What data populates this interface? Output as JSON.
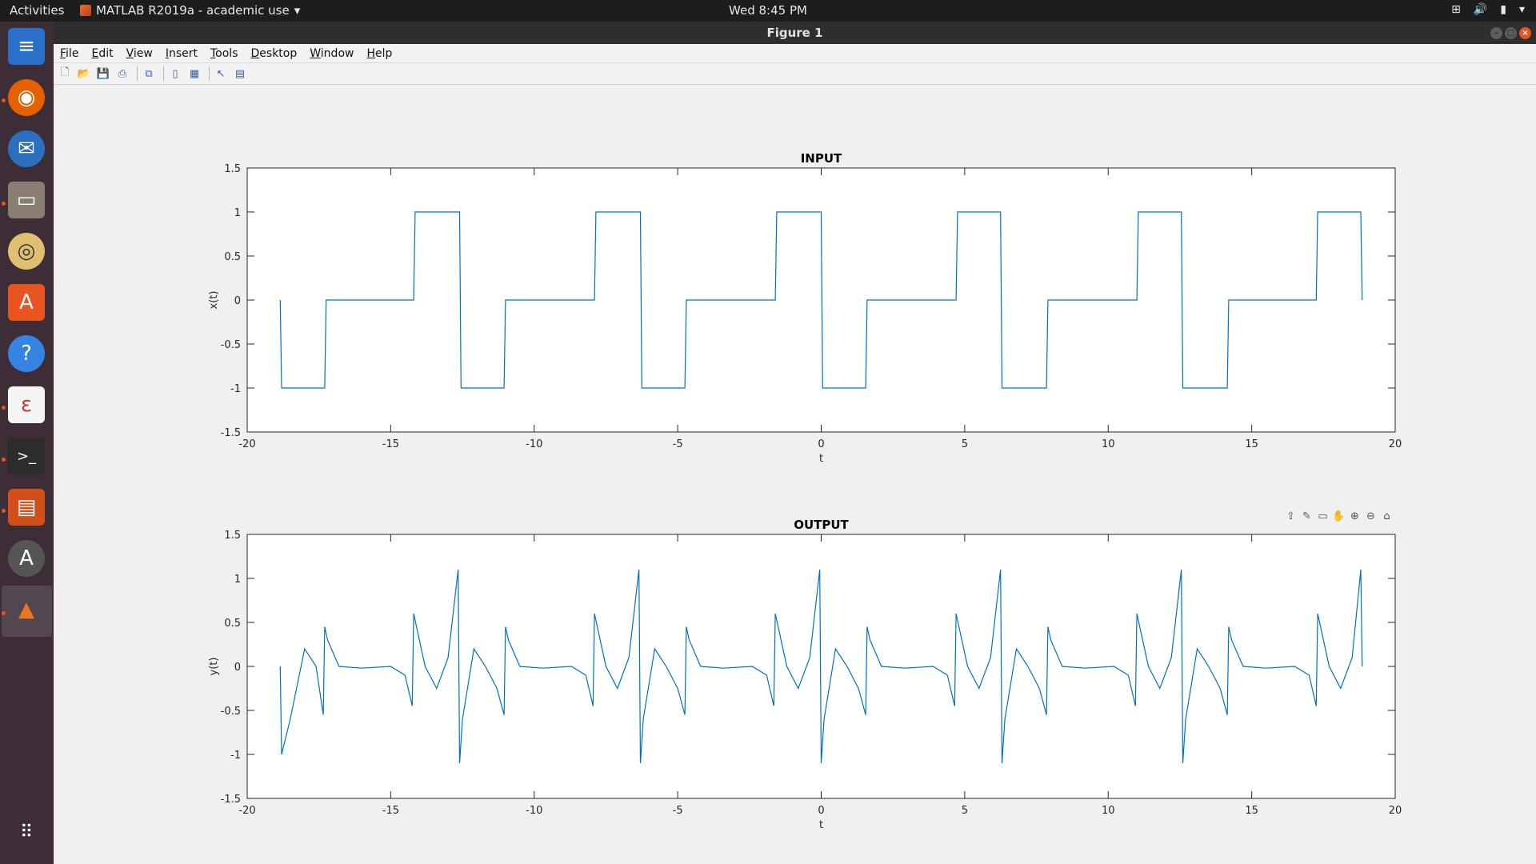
{
  "topbar": {
    "activities": "Activities",
    "app_menu": "MATLAB R2019a - academic use",
    "clock": "Wed  8:45 PM"
  },
  "window": {
    "title": "Figure 1",
    "menu": [
      "File",
      "Edit",
      "View",
      "Insert",
      "Tools",
      "Desktop",
      "Window",
      "Help"
    ]
  },
  "dock": {
    "items": [
      "libreoffice-writer-icon",
      "firefox-icon",
      "thunderbird-icon",
      "files-icon",
      "rhythmbox-icon",
      "software-center-icon",
      "help-icon",
      "document-viewer-icon",
      "terminal-icon",
      "libreoffice-impress-icon",
      "software-updater-icon",
      "matlab-icon",
      "show-applications-icon"
    ]
  },
  "toolbar": {
    "buttons": [
      "new-figure-icon",
      "open-file-icon",
      "save-icon",
      "print-icon",
      "link-plot-icon",
      "insert-colorbar-icon",
      "insert-legend-icon",
      "edit-plot-icon",
      "property-inspector-icon"
    ]
  },
  "axes_toolbar": {
    "buttons": [
      "export-icon",
      "brush-icon",
      "data-tips-icon",
      "pan-icon",
      "zoom-in-icon",
      "zoom-out-icon",
      "home-icon"
    ]
  },
  "colors": {
    "line": "#0072bd",
    "topbar": "#1d1d1d",
    "dock": "#3d2d36",
    "accent": "#e95420"
  },
  "chart_data": [
    {
      "type": "line",
      "title": "INPUT",
      "xlabel": "t",
      "ylabel": "x(t)",
      "xlim": [
        -20,
        20
      ],
      "ylim": [
        -1.5,
        1.5
      ],
      "xticks": [
        -20,
        -15,
        -10,
        -5,
        0,
        5,
        10,
        15,
        20
      ],
      "yticks": [
        -1.5,
        -1,
        -0.5,
        0,
        0.5,
        1,
        1.5
      ],
      "grid": false,
      "series": [
        {
          "description_of_shape": "",
          "x": [
            -18.85,
            -18.8,
            -17.3,
            -17.25,
            -14.2,
            -14.15,
            -12.6,
            -12.55,
            -11.05,
            -11.0,
            -7.9,
            -7.85,
            -6.3,
            -6.25,
            -4.75,
            -4.7,
            -1.6,
            -1.55,
            0.0,
            0.05,
            1.55,
            1.6,
            4.7,
            4.75,
            6.25,
            6.3,
            7.85,
            7.9,
            11.0,
            11.05,
            12.55,
            12.6,
            14.15,
            14.2,
            17.25,
            17.3,
            18.8,
            18.85
          ],
          "y": [
            0,
            -1,
            -1,
            0,
            0,
            1,
            1,
            -1,
            -1,
            0,
            0,
            1,
            1,
            -1,
            -1,
            0,
            0,
            1,
            1,
            -1,
            -1,
            0,
            0,
            1,
            1,
            -1,
            -1,
            0,
            0,
            1,
            1,
            -1,
            -1,
            0,
            0,
            1,
            1,
            0
          ]
        }
      ]
    },
    {
      "type": "line",
      "title": "OUTPUT",
      "xlabel": "t",
      "ylabel": "y(t)",
      "xlim": [
        -20,
        20
      ],
      "ylim": [
        -1.5,
        1.5
      ],
      "xticks": [
        -20,
        -15,
        -10,
        -5,
        0,
        5,
        10,
        15,
        20
      ],
      "yticks": [
        -1.5,
        -1,
        -0.5,
        0,
        0.5,
        1,
        1.5
      ],
      "grid": false,
      "series": [
        {
          "x": [
            -18.85,
            -18.8,
            -18.5,
            -18.0,
            -17.6,
            -17.35,
            -17.3,
            -17.2,
            -16.8,
            -16.0,
            -15.0,
            -14.5,
            -14.25,
            -14.2,
            -13.8,
            -13.4,
            -13.0,
            -12.65,
            -12.6,
            -12.5,
            -12.1,
            -11.7,
            -11.3,
            -11.05,
            -11.0,
            -10.9,
            -10.5,
            -9.7,
            -8.7,
            -8.2,
            -7.95,
            -7.9,
            -7.5,
            -7.1,
            -6.7,
            -6.35,
            -6.3,
            -6.2,
            -5.8,
            -5.4,
            -5.0,
            -4.75,
            -4.7,
            -4.6,
            -4.2,
            -3.4,
            -2.4,
            -1.9,
            -1.65,
            -1.6,
            -1.2,
            -0.8,
            -0.4,
            -0.05,
            0.0,
            0.1,
            0.5,
            0.9,
            1.3,
            1.55,
            1.6,
            1.7,
            2.1,
            2.9,
            3.9,
            4.4,
            4.65,
            4.7,
            5.1,
            5.5,
            5.9,
            6.25,
            6.3,
            6.4,
            6.8,
            7.2,
            7.6,
            7.85,
            7.9,
            8.0,
            8.4,
            9.2,
            10.2,
            10.7,
            10.95,
            11.0,
            11.4,
            11.8,
            12.2,
            12.55,
            12.6,
            12.7,
            13.1,
            13.5,
            13.9,
            14.15,
            14.2,
            14.3,
            14.7,
            15.5,
            16.5,
            17.0,
            17.25,
            17.3,
            17.7,
            18.1,
            18.5,
            18.8,
            18.85
          ],
          "y": [
            0,
            -1.0,
            -0.6,
            0.2,
            0.0,
            -0.55,
            0.45,
            0.3,
            0.0,
            -0.02,
            0.0,
            -0.1,
            -0.45,
            0.6,
            0.0,
            -0.25,
            0.1,
            1.1,
            -1.1,
            -0.6,
            0.2,
            0.0,
            -0.25,
            -0.55,
            0.45,
            0.3,
            0.0,
            -0.02,
            0.0,
            -0.1,
            -0.45,
            0.6,
            0.0,
            -0.25,
            0.1,
            1.1,
            -1.1,
            -0.6,
            0.2,
            0.0,
            -0.25,
            -0.55,
            0.45,
            0.3,
            0.0,
            -0.02,
            0.0,
            -0.1,
            -0.45,
            0.6,
            0.0,
            -0.25,
            0.1,
            1.1,
            -1.1,
            -0.6,
            0.2,
            0.0,
            -0.25,
            -0.55,
            0.45,
            0.3,
            0.0,
            -0.02,
            0.0,
            -0.1,
            -0.45,
            0.6,
            0.0,
            -0.25,
            0.1,
            1.1,
            -1.1,
            -0.6,
            0.2,
            0.0,
            -0.25,
            -0.55,
            0.45,
            0.3,
            0.0,
            -0.02,
            0.0,
            -0.1,
            -0.45,
            0.6,
            0.0,
            -0.25,
            0.1,
            1.1,
            -1.1,
            -0.6,
            0.2,
            0.0,
            -0.25,
            -0.55,
            0.45,
            0.3,
            0.0,
            -0.02,
            0.0,
            -0.1,
            -0.45,
            0.6,
            0.0,
            -0.25,
            0.1,
            1.1,
            0
          ]
        }
      ]
    }
  ]
}
